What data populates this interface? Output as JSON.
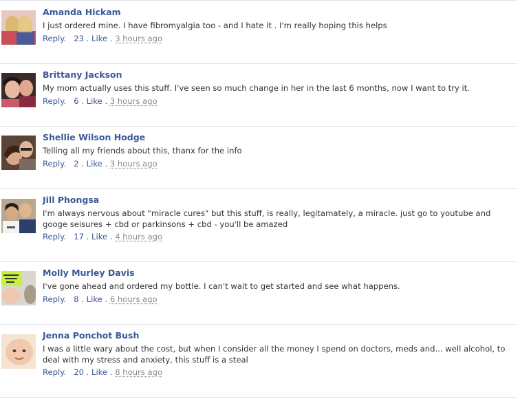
{
  "comments": [
    {
      "name": "Amanda Hickam",
      "text": "I just ordered mine. I have fibromyalgia too - and I hate it . I'm really hoping this helps",
      "reply": "Reply.",
      "likes": "23",
      "dot": ".",
      "like": "Like",
      "time": "3 hours ago"
    },
    {
      "name": "Brittany Jackson",
      "text": "My mom actually uses this stuff. I've seen so much change in her in the last 6 months, now I want to try it.",
      "reply": "Reply.",
      "likes": "6",
      "dot": ".",
      "like": "Like",
      "time": "3 hours ago"
    },
    {
      "name": "Shellie Wilson Hodge",
      "text": "Telling all my friends about this, thanx for the info",
      "reply": "Reply.",
      "likes": "2",
      "dot": ".",
      "like": "Like",
      "time": "3 hours ago"
    },
    {
      "name": "Jill Phongsa",
      "text": "I'm always nervous about \"miracle cures\" but this stuff, is really, legitamately, a miracle. just go to youtube and googe seisures + cbd or parkinsons + cbd - you'll be amazed",
      "reply": "Reply.",
      "likes": "17",
      "dot": ".",
      "like": "Like",
      "time": "4 hours ago"
    },
    {
      "name": "Molly Murley Davis",
      "text": "I've gone ahead and ordered my bottle. I can't wait to get started and see what happens.",
      "reply": "Reply.",
      "likes": "8",
      "dot": ".",
      "like": "Like",
      "time": "6 hours ago"
    },
    {
      "name": "Jenna Ponchot Bush",
      "text": "I was a little wary about the cost, but when I consider all the money I spend on doctors, meds and... well alcohol, to deal with my stress and anxiety, this stuff is a steal",
      "reply": "Reply.",
      "likes": "20",
      "dot": ".",
      "like": "Like",
      "time": "8 hours ago"
    }
  ],
  "colors": {
    "name": "#3b5998",
    "text": "#333333",
    "timestamp": "#8a8a8a",
    "divider": "#e1e2e6"
  }
}
